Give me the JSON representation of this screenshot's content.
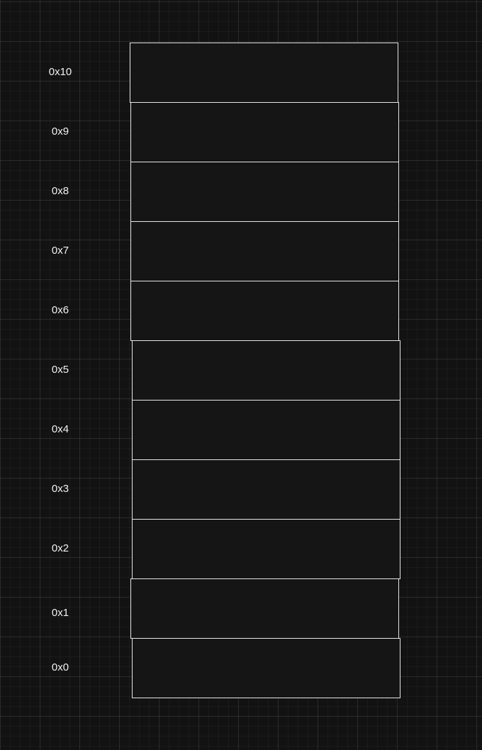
{
  "memory_diagram": {
    "cells": [
      {
        "address": "0x10"
      },
      {
        "address": "0x9"
      },
      {
        "address": "0x8"
      },
      {
        "address": "0x7"
      },
      {
        "address": "0x6"
      },
      {
        "address": "0x5"
      },
      {
        "address": "0x4"
      },
      {
        "address": "0x3"
      },
      {
        "address": "0x2"
      },
      {
        "address": "0x1"
      },
      {
        "address": "0x0"
      }
    ]
  },
  "colors": {
    "background": "#121212",
    "cell_fill": "#151515",
    "cell_border": "#e6e6e6",
    "label_text": "#f2f2f2"
  }
}
